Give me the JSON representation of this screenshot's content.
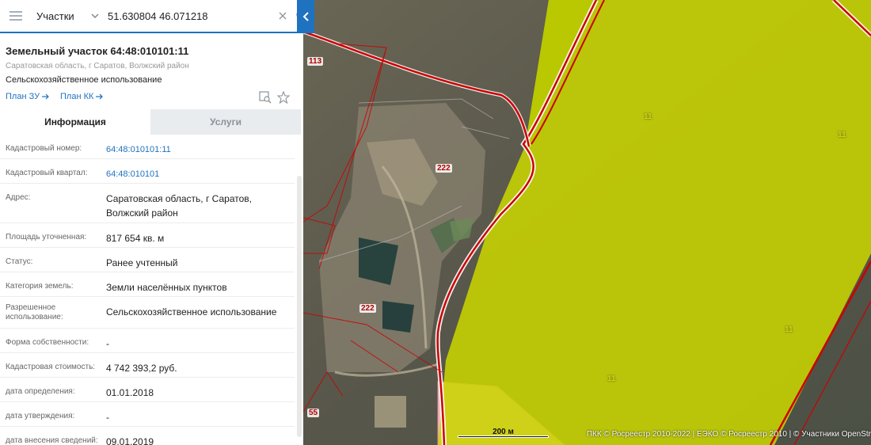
{
  "search": {
    "type_label": "Участки",
    "query": "51.630804 46.071218"
  },
  "parcel": {
    "title": "Земельный участок 64:48:010101:11",
    "address": "Саратовская область, г Саратов, Волжский район",
    "use": "Сельскохозяйственное использование",
    "plan_zu": "План ЗУ",
    "plan_kk": "План КК"
  },
  "tabs": {
    "info": "Информация",
    "services": "Услуги"
  },
  "info_rows": [
    {
      "label": "Кадастровый номер:",
      "value": "64:48:010101:11"
    },
    {
      "label": "Кадастровый квартал:",
      "value": "64:48:010101"
    },
    {
      "label": "Адрес:",
      "value": "Саратовская область, г Саратов, Волжский район"
    },
    {
      "label": "Площадь уточненная:",
      "value": "817 654 кв. м"
    },
    {
      "label": "Статус:",
      "value": "Ранее учтенный"
    },
    {
      "label": "Категория земель:",
      "value": "Земли населённых пунктов"
    },
    {
      "label": "Разрешенное использование:",
      "value": "Сельскохозяйственное использование"
    },
    {
      "label": "Форма собственности:",
      "value": "-"
    },
    {
      "label": "Кадастровая стоимость:",
      "value": "4 742 393,2 руб."
    },
    {
      "label": "дата определения:",
      "value": "01.01.2018"
    },
    {
      "label": "дата утверждения:",
      "value": "-"
    },
    {
      "label": "дата внесения сведений:",
      "value": "09.01.2019"
    }
  ],
  "map": {
    "labels": {
      "l113": "113",
      "l222a": "222",
      "l222b": "222",
      "l55": "55",
      "l11a": "11",
      "l11b": "11",
      "l11c": "11",
      "l11d": "11"
    },
    "scale": "200 м",
    "attribution": "ПКК © Росреестр 2010-2022 | ЕЭКО © Росреестр 2010 | © Участники OpenStr"
  },
  "colors": {
    "accent": "#1f72c0",
    "parcel_fill": "#c8d400",
    "boundary": "#cc0000",
    "pink_parcel": "#f4b8c0"
  },
  "icons": [
    "menu-icon",
    "chevron-down-icon",
    "close-icon",
    "search-icon",
    "collapse-arrow-icon",
    "arrow-right-icon",
    "find-on-map-icon",
    "star-icon"
  ]
}
